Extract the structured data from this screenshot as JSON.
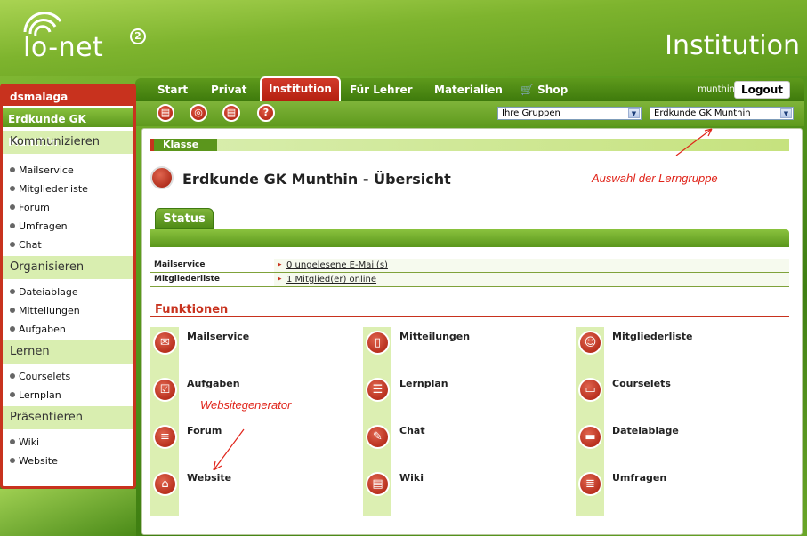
{
  "header": {
    "logo_text": "lo-net",
    "logo_sup": "2",
    "section_title": "Institution"
  },
  "nav": {
    "tabs": [
      "Start",
      "Privat",
      "Institution",
      "Für Lehrer",
      "Materialien",
      "Shop"
    ],
    "active_tab": "Institution",
    "user": "munthin",
    "logout": "Logout"
  },
  "toolbar": {
    "icons": [
      "tb-icon-1",
      "tb-icon-2",
      "tb-icon-3",
      "help-icon"
    ],
    "select_groups": "Ihre Gruppen",
    "select_course": "Erdkunde GK Munthin"
  },
  "sidebar": {
    "user": "dsmalaga",
    "group": "Erdkunde GK Munthin",
    "sections": [
      {
        "title": "Kommunizieren",
        "items": [
          "Mailservice",
          "Mitgliederliste",
          "Forum",
          "Umfragen",
          "Chat"
        ]
      },
      {
        "title": "Organisieren",
        "items": [
          "Dateiablage",
          "Mitteilungen",
          "Aufgaben"
        ]
      },
      {
        "title": "Lernen",
        "items": [
          "Courselets",
          "Lernplan"
        ]
      },
      {
        "title": "Präsentieren",
        "items": [
          "Wiki",
          "Website"
        ]
      }
    ]
  },
  "main": {
    "klasse": "Klasse",
    "title": "Erdkunde GK Munthin - Übersicht",
    "annotation_select": "Auswahl der Lerngruppe",
    "annotation_website": "Websitegenerator",
    "status_tab": "Status",
    "status_rows": [
      {
        "key": "Mailservice",
        "value": "0 ungelesene E-Mail(s)"
      },
      {
        "key": "Mitgliederliste",
        "value": "1 Mitglied(er) online"
      }
    ],
    "functions_title": "Funktionen",
    "functions": [
      [
        "Mailservice",
        "Mitteilungen",
        "Mitgliederliste"
      ],
      [
        "Aufgaben",
        "Lernplan",
        "Courselets"
      ],
      [
        "Forum",
        "Chat",
        "Dateiablage"
      ],
      [
        "Website",
        "Wiki",
        "Umfragen"
      ]
    ]
  },
  "colors": {
    "accent_red": "#c8321e",
    "brand_green": "#5b961c",
    "light_green": "#dcefb2"
  }
}
